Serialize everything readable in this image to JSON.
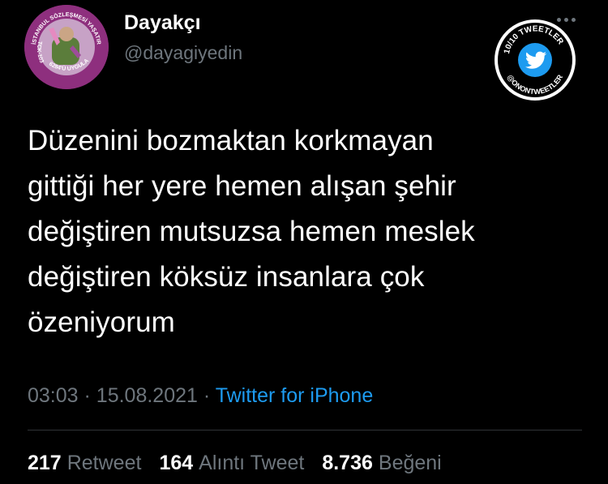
{
  "author": {
    "display_name": "Dayakçı",
    "handle": "@dayagiyedin",
    "avatar_text_top": "İSTANBUL SÖZLEŞMESİ YAŞATIR",
    "avatar_text_left": "TCK-103",
    "avatar_text_bottom": "6284'Ü UYGULA"
  },
  "badge": {
    "text": "10/10 TWEETLER",
    "handle": "@ONONTWEETLER",
    "icon": "twitter-bird-icon",
    "accent": "#1d9bf0"
  },
  "tweet": {
    "text": "Düzenini bozmaktan korkmayan\ngittiği her yere hemen alışan şehir\ndeğiştiren mutsuzsa hemen meslek\ndeğiştiren köksüz insanlara çok\nözeniyorum"
  },
  "meta": {
    "time": "03:03",
    "date": "15.08.2021",
    "separator": "·",
    "source": "Twitter for iPhone"
  },
  "stats": {
    "retweets": "217",
    "retweets_label": "Retweet",
    "quotes": "164",
    "quotes_label": "Alıntı Tweet",
    "likes": "8.736",
    "likes_label": "Beğeni"
  },
  "colors": {
    "background": "#000000",
    "text": "#ffffff",
    "muted": "#6e767d",
    "link": "#1d9bf0",
    "avatar": "#8e2f7e"
  }
}
